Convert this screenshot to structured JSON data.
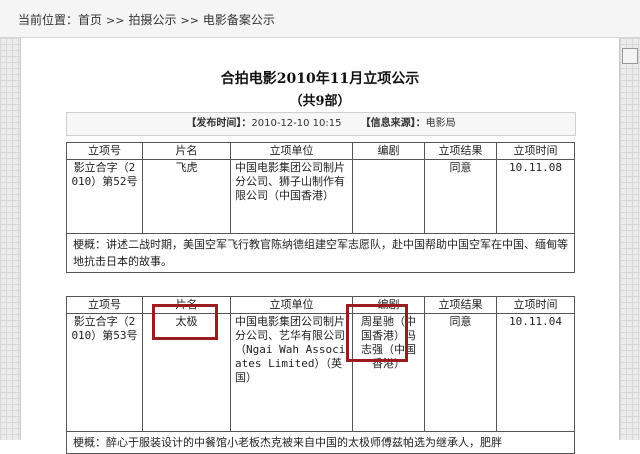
{
  "location": {
    "label": "当前位置：",
    "crumbs": [
      "首页",
      "拍摄公示",
      "电影备案公示"
    ],
    "separator": ">>"
  },
  "notice": {
    "title": "合拍电影2010年11月立项公示",
    "count": "（共9部）",
    "published_label": "【发布时间】：",
    "published_value": "2010-12-10 10:15",
    "source_label": "【信息来源】：",
    "source_value": "电影局"
  },
  "columns": [
    "立项号",
    "片名",
    "立项单位",
    "编剧",
    "立项结果",
    "立项时间"
  ],
  "records": [
    {
      "number": "影立合字（2010）第52号",
      "title": "飞虎",
      "company": "中国电影集团公司制片分公司、狮子山制作有限公司（中国香港）",
      "writer": "",
      "result": "同意",
      "date": "10.11.08",
      "synopsis": "梗概：讲述二战时期，美国空军飞行教官陈纳德组建空军志愿队，赴中国帮助中国空军在中国、缅甸等地抗击日本的故事。"
    },
    {
      "number": "影立合字（2010）第53号",
      "title": "太极",
      "company": "中国电影集团公司制片分公司、艺华有限公司（Ngai Wah Associates Limited）（英国）",
      "writer": "周星驰（中国香港）冯志强（中国香港）",
      "result": "同意",
      "date": "10.11.04",
      "synopsis": "梗概：醉心于服装设计的中餐馆小老板杰克被来自中国的太极师傅兹帕选为继承人，肥胖"
    }
  ],
  "colors": {
    "highlight": "#9b1c1c"
  }
}
